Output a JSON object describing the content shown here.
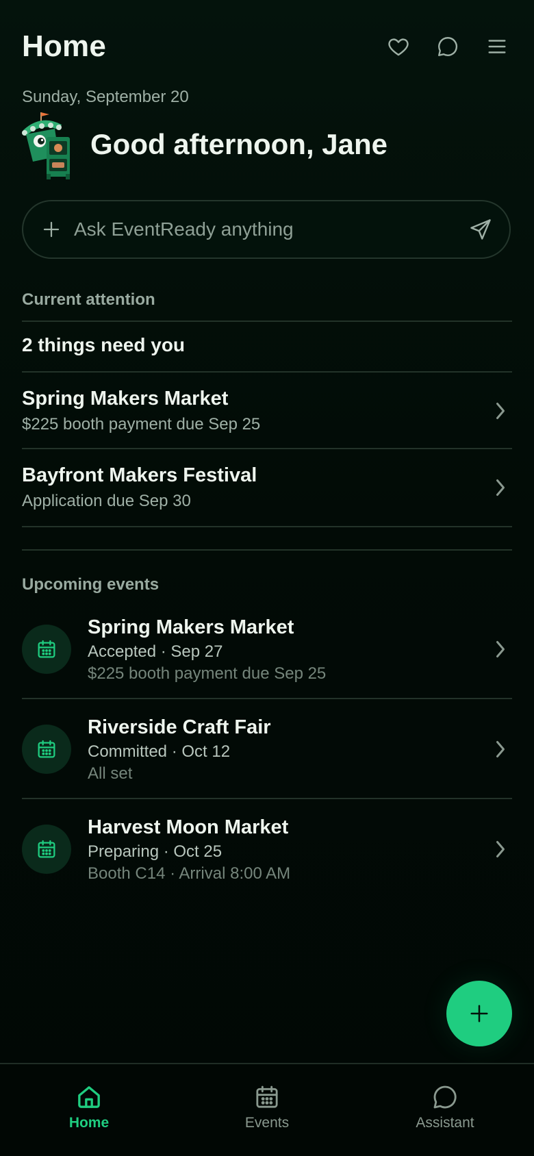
{
  "header": {
    "title": "Home",
    "icons": [
      "heart-icon",
      "chat-icon",
      "menu-icon"
    ]
  },
  "greeting": {
    "date": "Sunday, September 20",
    "text": "Good afternoon, Jane"
  },
  "ask": {
    "placeholder": "Ask EventReady anything"
  },
  "attention": {
    "section_label": "Current attention",
    "count_text": "2 things need you",
    "items": [
      {
        "title": "Spring Makers Market",
        "subtitle": "$225 booth payment due Sep 25"
      },
      {
        "title": "Bayfront Makers Festival",
        "subtitle": "Application due Sep 30"
      }
    ]
  },
  "upcoming": {
    "section_label": "Upcoming events",
    "items": [
      {
        "title": "Spring Makers Market",
        "status": "Accepted · Sep 27",
        "note": "$225 booth payment due Sep 25"
      },
      {
        "title": "Riverside Craft Fair",
        "status": "Committed · Oct 12",
        "note": "All set"
      },
      {
        "title": "Harvest Moon Market",
        "status": "Preparing · Oct 25",
        "note": "Booth C14 · Arrival 8:00 AM"
      }
    ]
  },
  "nav": {
    "items": [
      {
        "label": "Home",
        "icon": "home-icon",
        "active": true
      },
      {
        "label": "Events",
        "icon": "calendar-icon",
        "active": false
      },
      {
        "label": "Assistant",
        "icon": "chat-icon",
        "active": false
      }
    ]
  },
  "colors": {
    "background": "#020a06",
    "accent": "#1fcd80",
    "text_primary": "#eef5ee",
    "text_secondary": "#9fb0a6",
    "divider": "#233329"
  }
}
